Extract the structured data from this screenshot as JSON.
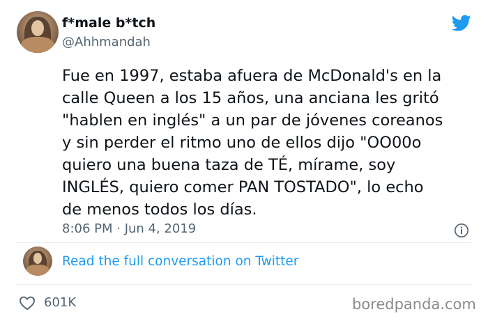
{
  "author": {
    "display_name": "f*male b*tch",
    "handle": "@Ahhmandah"
  },
  "tweet": {
    "text_lines": [
      "Fue en 1997, estaba afuera de McDonald's en la",
      "calle Queen a los 15 años, una anciana les gritó",
      "\"hablen en inglés\" a un par de jóvenes coreanos",
      "y sin perder el ritmo uno de ellos dijo \"OO00o",
      "quiero una buena taza de TÉ, mírame, soy",
      "INGLÉS, quiero comer PAN TOSTADO\", lo echo",
      "de menos todos los días."
    ],
    "timestamp": "8:06 PM · Jun 4, 2019"
  },
  "conversation": {
    "link_label": "Read the full conversation on Twitter"
  },
  "engagement": {
    "likes": "601K"
  },
  "watermark": "boredpanda.com",
  "colors": {
    "twitter_blue": "#1d9bf0",
    "text_primary": "#0f1419",
    "text_secondary": "#536471",
    "divider": "#e6ecf0"
  },
  "icons": {
    "brand": "twitter-bird-icon",
    "info": "info-icon",
    "like": "heart-icon"
  }
}
